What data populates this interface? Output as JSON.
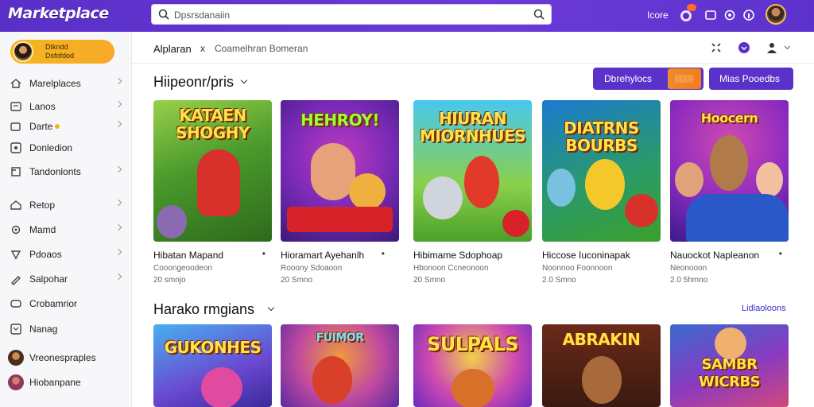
{
  "app": {
    "logo": "Marketplace",
    "search_placeholder": "Dpsrsdanaiin",
    "user_label": "Icore"
  },
  "sidebar": {
    "profile_line1": "Dtkndd",
    "profile_line2": "Dsfofdod",
    "items": [
      {
        "label": "Marelplaces",
        "icon": "home-icon"
      },
      {
        "label": "Lanos",
        "icon": "list-icon"
      },
      {
        "label": "Darte",
        "icon": "cart-icon"
      },
      {
        "label": "Donledion",
        "icon": "download-icon"
      },
      {
        "label": "Tandonlonts",
        "icon": "tag-icon"
      },
      {
        "label": "Retop",
        "icon": "house-icon"
      },
      {
        "label": "Mamd",
        "icon": "gear-icon"
      },
      {
        "label": "Pdoaos",
        "icon": "bookmark-icon"
      },
      {
        "label": "Salpohar",
        "icon": "pen-icon"
      },
      {
        "label": "Crobamrior",
        "icon": "card-icon"
      },
      {
        "label": "Nanag",
        "icon": "arrow-icon"
      },
      {
        "label": "Vreonespraples",
        "icon": "avatar-icon"
      },
      {
        "label": "Hiobanpane",
        "icon": "avatar-icon"
      }
    ]
  },
  "main": {
    "breadcrumb": {
      "first": "Alplaran",
      "sep": "x",
      "second": "Coamelhran Bomeran"
    },
    "section1": {
      "title": "Hiipeonr/pris",
      "button_primary": "Dbrehylocs",
      "button_secondary": "Mias Pooedbs"
    },
    "section2": {
      "title": "Harako rmgians",
      "see_all": "Lidlaoloons"
    },
    "games_row1": [
      {
        "thumb_title": "KATAEN SHOGHY",
        "title": "Hibatan Mapand",
        "subtitle": "Cooongeoodeon",
        "price": "20 smnjo"
      },
      {
        "thumb_title": "HEHROY!",
        "title": "Hioramart Ayehanlh",
        "subtitle": "Rooony Sdoaoon",
        "price": "20 Smno"
      },
      {
        "thumb_title": "HIURAN MIORNHUES",
        "title": "Hibimame Sdophoap",
        "subtitle": "Hbonoon Ccneonoon",
        "price": "20 Smno"
      },
      {
        "thumb_title": "DIATRNS BOURBS",
        "title": "Hiccose Iuconinapak",
        "subtitle": "Noonnoo Foonnoon",
        "price": "2.0 Smno"
      },
      {
        "thumb_title": "Hoocern",
        "title": "Nauockot Napleanon",
        "subtitle": "Neonooon",
        "price": "2.0 5hmno"
      }
    ],
    "games_row2": [
      {
        "thumb_title": "GUKONHES"
      },
      {
        "thumb_title": "FUIMOR"
      },
      {
        "thumb_title": "SULPALS"
      },
      {
        "thumb_title": "ABRAKIN"
      },
      {
        "thumb_title": "SAMBR WICRBS"
      }
    ]
  }
}
